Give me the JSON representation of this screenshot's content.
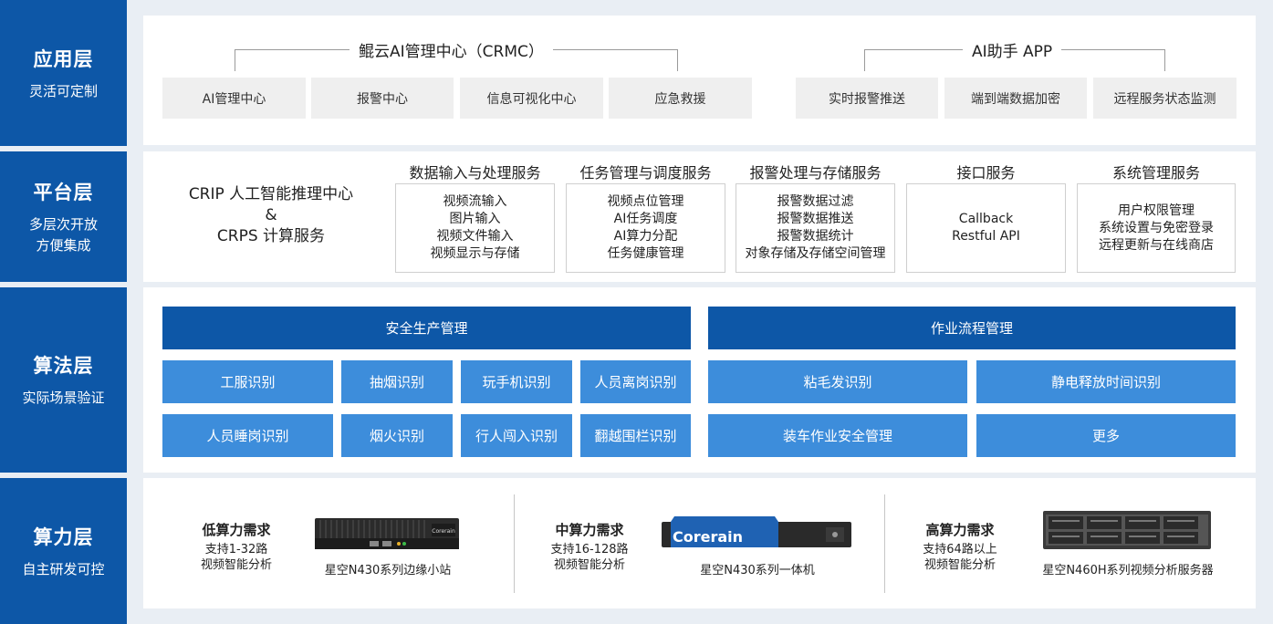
{
  "layers": [
    {
      "title": "应用层",
      "subtitle": "灵活可定制"
    },
    {
      "title": "平台层",
      "subtitle": "多层次开放\n方便集成"
    },
    {
      "title": "算法层",
      "subtitle": "实际场景验证"
    },
    {
      "title": "算力层",
      "subtitle": "自主研发可控"
    }
  ],
  "app": {
    "group1": {
      "title": "鲲云AI管理中心（CRMC）",
      "items": [
        "AI管理中心",
        "报警中心",
        "信息可视化中心",
        "应急救援"
      ]
    },
    "group2": {
      "title": "AI助手 APP",
      "items": [
        "实时报警推送",
        "端到端数据加密",
        "远程服务状态监测"
      ]
    }
  },
  "platform": {
    "center": {
      "line1": "CRIP 人工智能推理中心",
      "line2": "&",
      "line3": "CRPS 计算服务"
    },
    "services": [
      {
        "title": "数据输入与处理服务",
        "items": [
          "视频流输入",
          "图片输入",
          "视频文件输入",
          "视频显示与存储"
        ]
      },
      {
        "title": "任务管理与调度服务",
        "items": [
          "视频点位管理",
          "AI任务调度",
          "AI算力分配",
          "任务健康管理"
        ]
      },
      {
        "title": "报警处理与存储服务",
        "items": [
          "报警数据过滤",
          "报警数据推送",
          "报警数据统计",
          "对象存储及存储空间管理"
        ]
      },
      {
        "title": "接口服务",
        "items": [
          "Callback",
          "Restful API"
        ]
      },
      {
        "title": "系统管理服务",
        "items": [
          "用户权限管理",
          "系统设置与免密登录",
          "远程更新与在线商店"
        ]
      }
    ]
  },
  "algo": {
    "left": {
      "title": "安全生产管理",
      "items": [
        "工服识别",
        "抽烟识别",
        "玩手机识别",
        "人员离岗识别",
        "人员睡岗识别",
        "烟火识别",
        "行人闯入识别",
        "翻越围栏识别"
      ]
    },
    "right": {
      "title": "作业流程管理",
      "items": [
        "粘毛发识别",
        "静电释放时间识别",
        "装车作业安全管理",
        "更多"
      ]
    }
  },
  "compute": [
    {
      "need": "低算力需求",
      "desc1": "支持1-32路",
      "desc2": "视频智能分析",
      "product": "星空N430系列边缘小站",
      "brand": "Corerain"
    },
    {
      "need": "中算力需求",
      "desc1": "支持16-128路",
      "desc2": "视频智能分析",
      "product": "星空N430系列一体机",
      "brand": "Corerain"
    },
    {
      "need": "高算力需求",
      "desc1": "支持64路以上",
      "desc2": "视频智能分析",
      "product": "星空N460H系列视频分析服务器"
    }
  ],
  "colors": {
    "dark_blue": "#0d57a7",
    "light_blue": "#3d8ddb",
    "gray_box": "#efefef",
    "background": "#e9eef4"
  }
}
